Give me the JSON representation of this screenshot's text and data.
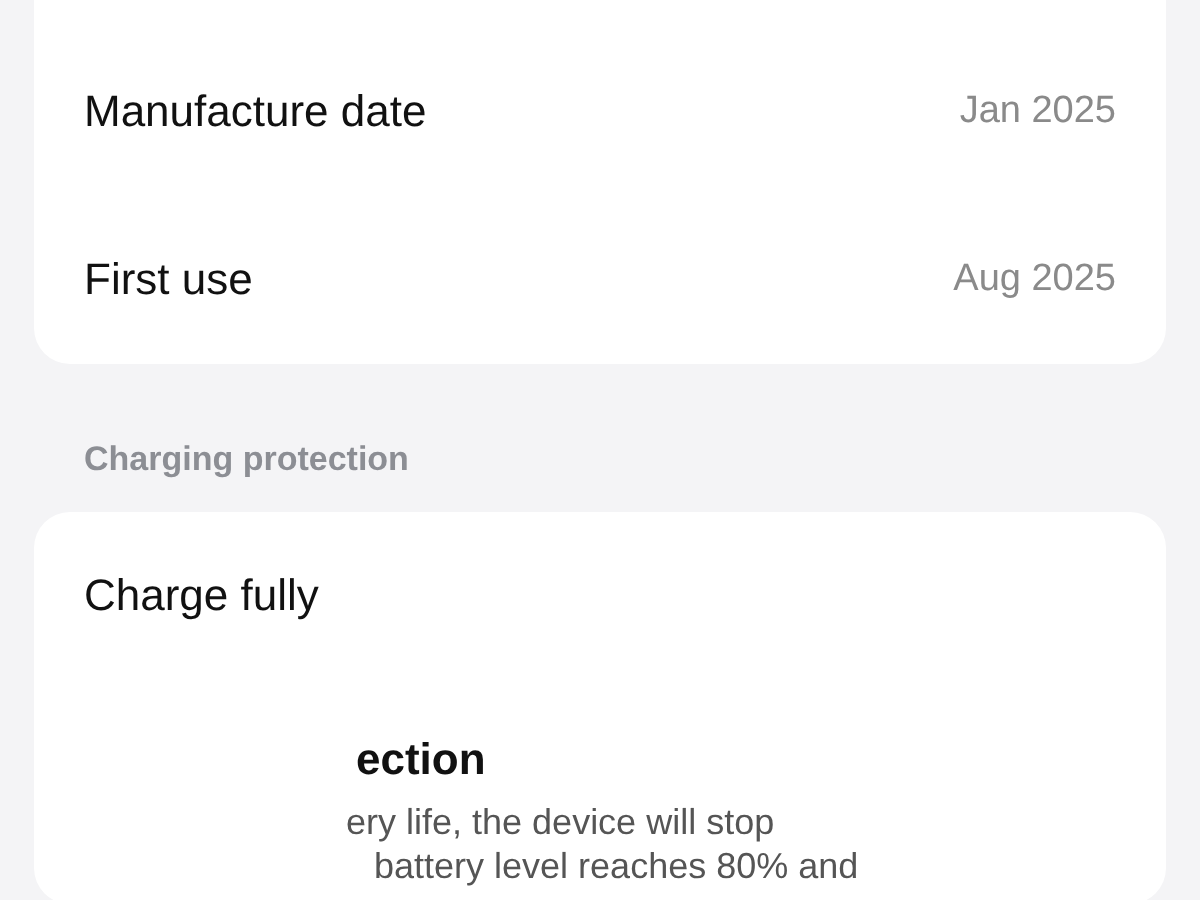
{
  "info_rows": [
    {
      "label": "Manufacture date",
      "value": "Jan 2025"
    },
    {
      "label": "First use",
      "value": "Aug 2025"
    }
  ],
  "section_header": "Charging protection",
  "protection_rows": [
    {
      "kind": "plain",
      "title": "Charge fully"
    },
    {
      "kind": "described",
      "title": "ection",
      "description": [
        "ery life, the device will stop",
        "battery level reaches 80% and"
      ]
    }
  ]
}
